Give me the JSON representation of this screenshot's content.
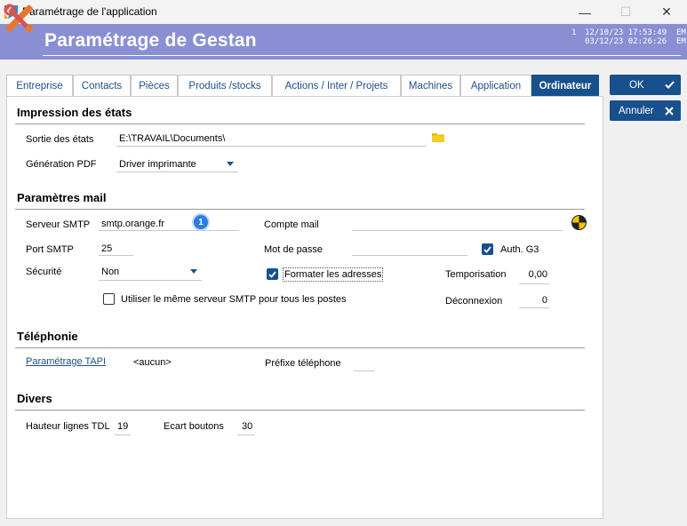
{
  "window": {
    "title": "Paramétrage de l'application",
    "minimize": "—",
    "maximize": "☐",
    "close": "✕"
  },
  "header": {
    "title": "Paramétrage de Gestan",
    "stamp_index": "1",
    "stamp_line1": "12/10/23 17:53:49  EM",
    "stamp_line2": "03/12/23 02:26:26  EM"
  },
  "tabs": [
    {
      "label": "Entreprise"
    },
    {
      "label": "Contacts"
    },
    {
      "label": "Pièces"
    },
    {
      "label": "Produits /stocks"
    },
    {
      "label": "Actions / Inter / Projets"
    },
    {
      "label": "Machines"
    },
    {
      "label": "Application"
    },
    {
      "label": "Ordinateur"
    }
  ],
  "actions": {
    "ok": "OK",
    "cancel": "Annuler"
  },
  "print": {
    "title": "Impression des états",
    "output_label": "Sortie des états",
    "output_value": "E:\\TRAVAIL\\Documents\\",
    "pdf_label": "Génération PDF",
    "pdf_value": "Driver imprimante"
  },
  "mail": {
    "title": "Paramètres mail",
    "smtp_label": "Serveur SMTP",
    "smtp_value": "smtp.orange.fr",
    "badge": "1",
    "account_label": "Compte mail",
    "account_value": "",
    "port_label": "Port SMTP",
    "port_value": "25",
    "password_label": "Mot de passe",
    "password_value": "",
    "auth_label": "Auth. G3",
    "security_label": "Sécurité",
    "security_value": "Non",
    "format_label": "Formater les adresses",
    "delay_label": "Temporisation",
    "delay_value": "0,00",
    "same_server_label": "Utiliser le même serveur SMTP pour tous les postes",
    "disconnect_label": "Déconnexion",
    "disconnect_value": "0"
  },
  "phone": {
    "title": "Téléphonie",
    "tapi_link": "Paramétrage TAPI",
    "tapi_value": "<aucun>",
    "prefix_label": "Préfixe téléphone",
    "prefix_value": ""
  },
  "misc": {
    "title": "Divers",
    "rows_label": "Hauteur lignes TDL",
    "rows_value": "19",
    "gap_label": "Ecart boutons",
    "gap_value": "30"
  }
}
